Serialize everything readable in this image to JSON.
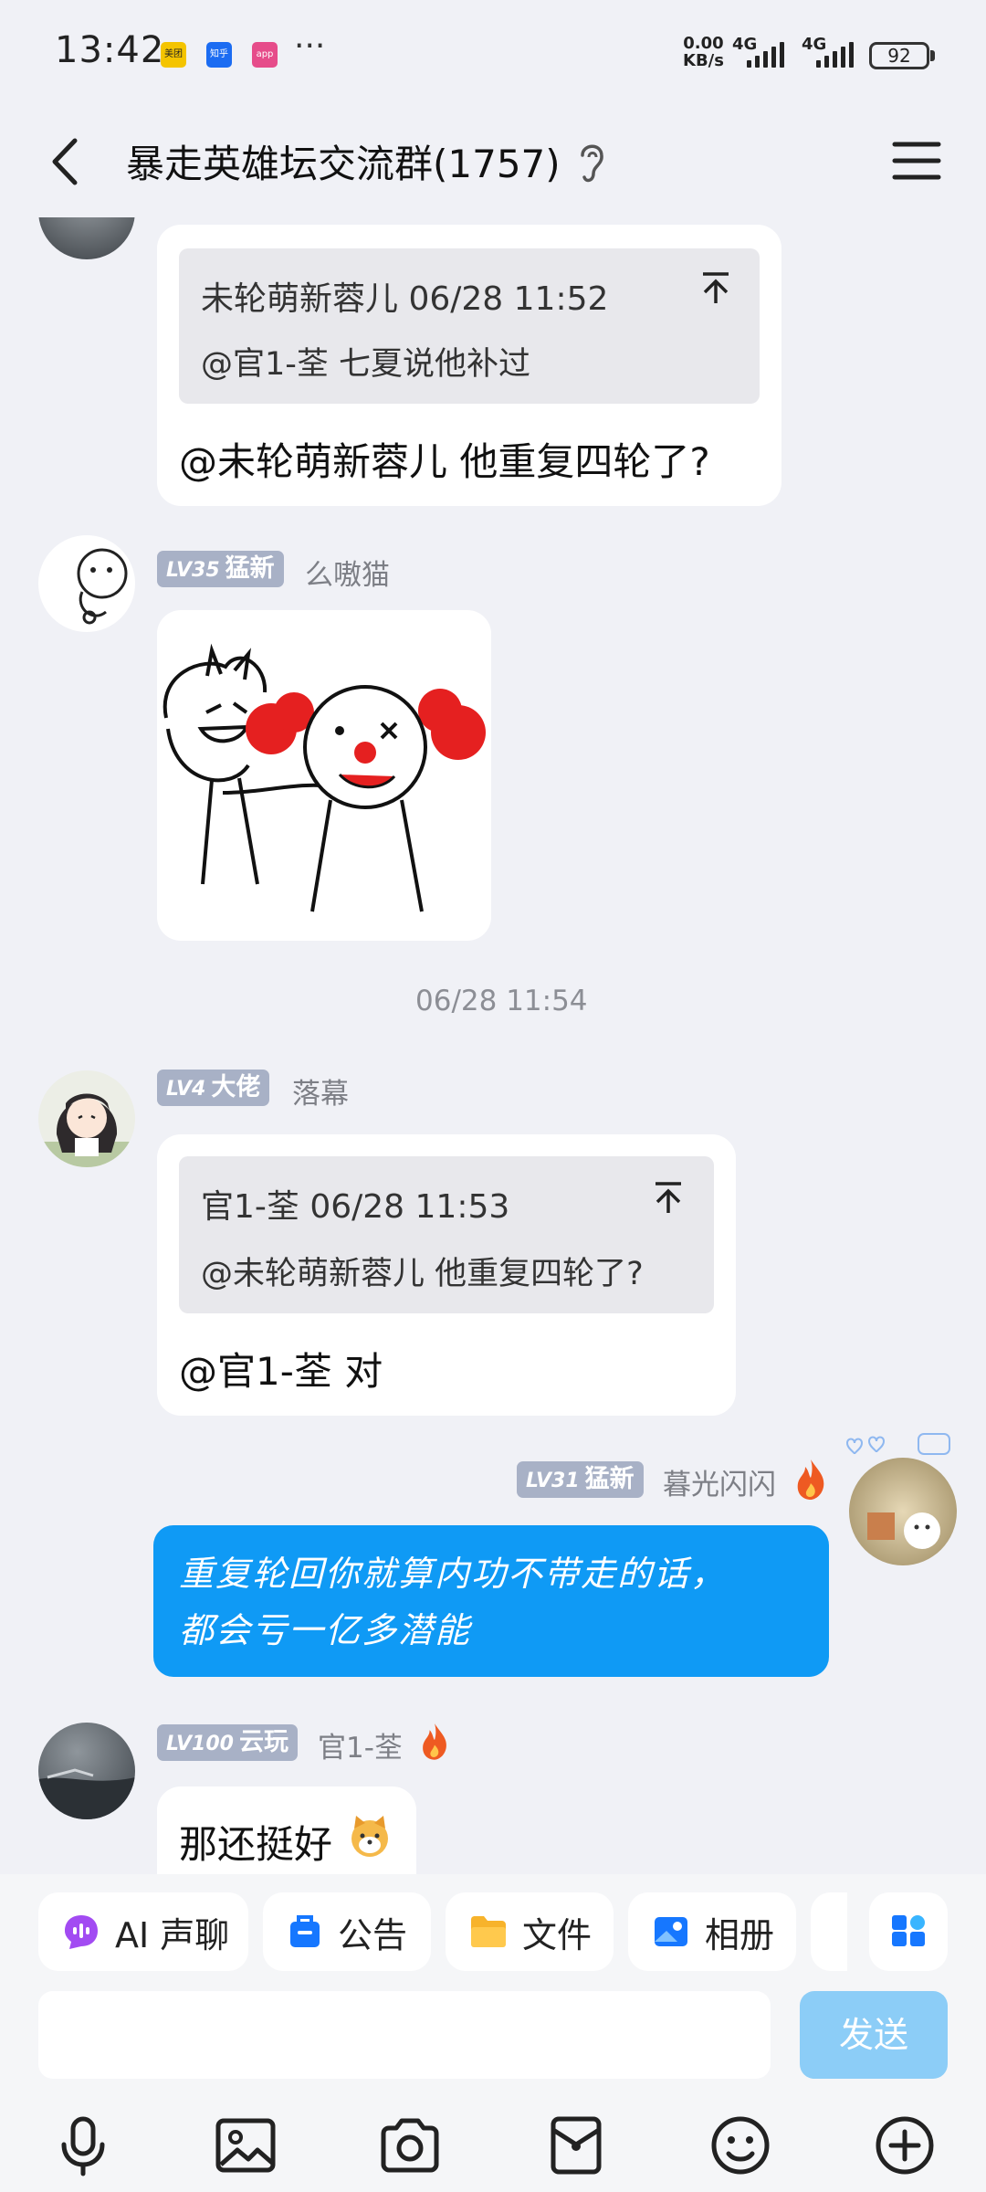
{
  "status_bar": {
    "time": "13:42",
    "app_icons": [
      {
        "name": "meituan-icon",
        "label": "美团",
        "color": "#f4c400"
      },
      {
        "name": "zhihu-icon",
        "label": "知乎",
        "color": "#1b6cf2"
      },
      {
        "name": "app-icon",
        "label": "app",
        "color": "#e64c8a"
      }
    ],
    "more": "···",
    "speed_value": "0.00",
    "speed_unit": "KB/s",
    "network1": "4G",
    "network2": "4G",
    "battery": "92"
  },
  "header": {
    "title": "暴走英雄坛交流群(1757)"
  },
  "messages": {
    "m1": {
      "quote_author": "未轮萌新蓉儿 06/28 11:52",
      "quote_text": "@官1-荃 七夏说他补过",
      "text": "@未轮萌新蓉儿 他重复四轮了?"
    },
    "m2": {
      "level": "LV35",
      "title": "猛新",
      "nickname": "么嗷猫"
    },
    "time_separator": "06/28 11:54",
    "m3": {
      "level": "LV4",
      "title": "大佬",
      "nickname": "落幕",
      "quote_author": "官1-荃 06/28 11:53",
      "quote_text": "@未轮萌新蓉儿 他重复四轮了?",
      "text": "@官1-荃 对"
    },
    "m4": {
      "level": "LV31",
      "title": "猛新",
      "nickname": "暮光闪闪",
      "text_line1": "重复轮回你就算内功不带走的话，",
      "text_line2": "都会亏一亿多潜能"
    },
    "m5": {
      "level": "LV100",
      "title": "云玩",
      "nickname": "官1-荃",
      "text": "那还挺好"
    }
  },
  "toolbar": {
    "ai_voice": "AI 声聊",
    "notice": "公告",
    "files": "文件",
    "album": "相册"
  },
  "input": {
    "placeholder": "",
    "send": "发送"
  },
  "colors": {
    "accent_blue": "#0f9af5",
    "send_disabled": "#8ccdf7",
    "badge_gray": "#a8b1c6",
    "background": "#f0f1f6"
  }
}
